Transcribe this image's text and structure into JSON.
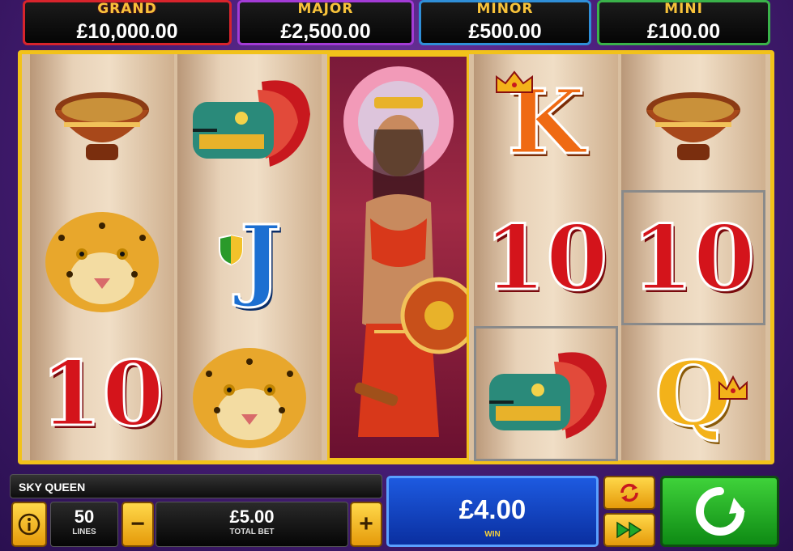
{
  "jackpots": [
    {
      "label": "GRAND",
      "value": "£10,000.00"
    },
    {
      "label": "MAJOR",
      "value": "£2,500.00"
    },
    {
      "label": "MINOR",
      "value": "£500.00"
    },
    {
      "label": "MINI",
      "value": "£100.00"
    }
  ],
  "reels": [
    [
      "bowl",
      "jaguar",
      "10"
    ],
    [
      "serpent",
      "J",
      "jaguar"
    ],
    [
      "sky-queen",
      "sky-queen",
      "sky-queen"
    ],
    [
      "K",
      "10",
      "serpent"
    ],
    [
      "bowl",
      "10",
      "Q"
    ]
  ],
  "symbol_text": {
    "ten": "10",
    "j": "J",
    "k": "K",
    "q": "Q"
  },
  "game": {
    "title": "SKY QUEEN"
  },
  "lines": {
    "value": "50",
    "label": "LINES"
  },
  "total_bet": {
    "value": "£5.00",
    "label": "TOTAL BET",
    "minus": "−",
    "plus": "+"
  },
  "win": {
    "value": "£4.00",
    "label": "WIN"
  },
  "colors": {
    "frame": "#f2c21a",
    "spin": "#1fa82a",
    "win": "#1d5ae0"
  }
}
